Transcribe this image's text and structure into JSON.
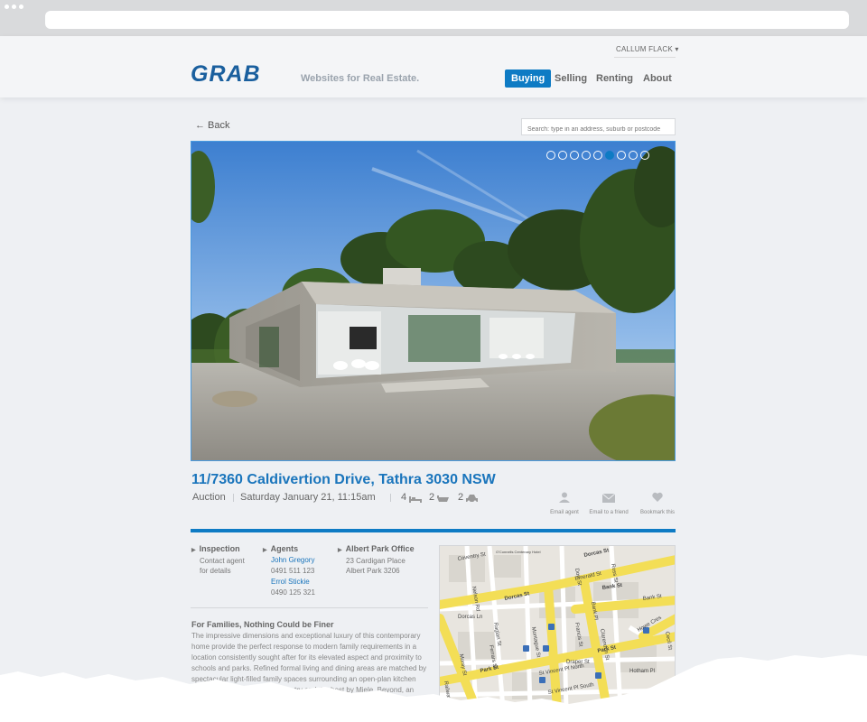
{
  "header": {
    "user_name": "CALLUM FLACK",
    "user_menu_icon": "caret-down-icon",
    "logo": "GRAB",
    "tagline": "Websites for Real Estate.",
    "nav": [
      {
        "label": "Buying",
        "active": true
      },
      {
        "label": "Selling",
        "active": false
      },
      {
        "label": "Renting",
        "active": false
      },
      {
        "label": "About",
        "active": false
      }
    ]
  },
  "toolbar": {
    "back_label": "← Back",
    "search_placeholder": "Search: type in an address, suburb or postcode"
  },
  "gallery": {
    "slide_count": 9,
    "active_index": 5
  },
  "listing": {
    "title": "11/7360 Caldivertion Drive, Tathra 3030 NSW",
    "sale_type": "Auction",
    "date": "Saturday January 21, 11:15am",
    "bedrooms": "4",
    "bathrooms": "2",
    "car_spaces": "2",
    "actions": [
      {
        "label": "Email agent",
        "icon": "person-icon"
      },
      {
        "label": "Email to a friend",
        "icon": "envelope-icon"
      },
      {
        "label": "Bookmark this",
        "icon": "heart-icon"
      }
    ]
  },
  "details": {
    "inspection": {
      "heading": "Inspection",
      "line1": "Contact agent",
      "line2": "for details"
    },
    "agents": {
      "heading": "Agents",
      "list": [
        {
          "name": "John Gregory",
          "phone": "0491 511 123"
        },
        {
          "name": "Errol Stickie",
          "phone": "0490 125 321"
        }
      ]
    },
    "office": {
      "heading": "Albert Park Office",
      "line1": "23 Cardigan Place",
      "line2": "Albert Park 3206"
    },
    "description_title": "For Families, Nothing Could be Finer",
    "description": "The impressive dimensions and exceptional luxury of this contemporary home provide the perfect response to modern family requirements in a location consistently sought after for its elevated aspect and proximity to schools and parks. Refined formal living and dining areas are matched by spectacular light-filled family spaces surrounding an open-plan kitchen with stone benches, butler's pantry and the best by Miele. Beyond, an entertaining deck with heating, speakers and BBQ"
  },
  "map": {
    "streets": [
      "Coventry St",
      "Dorcas St",
      "Dorcas St",
      "Emerald St",
      "Bank St",
      "Park St",
      "Park St",
      "Dorcas Ln",
      "Draper St",
      "St Vincent Pl North",
      "St Vincent Pl South",
      "Montague St",
      "Nelson Rd",
      "Ferrars St",
      "Cecil St",
      "Howe Cres",
      "Clarendon St",
      "Ross St",
      "Francis St",
      "Raglan St",
      "Hotham Pl",
      "Railway Pl",
      "Bank Pl",
      "Moray St",
      "O'Connells Centenary Hotel",
      "Dow St",
      "Bank St"
    ]
  },
  "colors": {
    "accent": "#0e7bc4",
    "title": "#1a75bc",
    "logo": "#1a5f9e"
  }
}
